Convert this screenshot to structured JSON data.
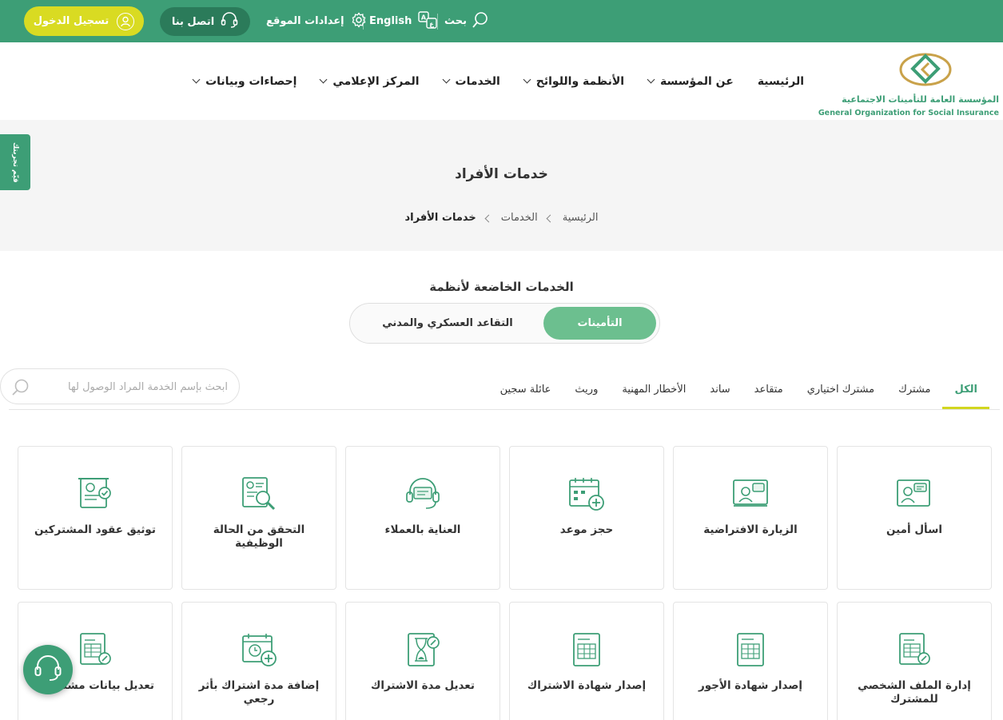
{
  "topbar": {
    "login_label": "تسجيل الدخول",
    "contact_label": "اتصل بنا",
    "settings_label": "إعدادات الموقع",
    "language_label": "English",
    "search_label": "بحث"
  },
  "logo": {
    "name_ar": "المؤسسة العامة للتأمينات الاجتماعية",
    "name_en": "General Organization for Social Insurance"
  },
  "mainnav": {
    "items": [
      {
        "label": "الرئيسية"
      },
      {
        "label": "عن المؤسسة"
      },
      {
        "label": "الأنظمة واللوائح"
      },
      {
        "label": "الخدمات"
      },
      {
        "label": "المركز الإعلامي"
      },
      {
        "label": "إحصاءات وبيانات"
      }
    ]
  },
  "sidebar_tab": {
    "label": "قيّم تجربتك"
  },
  "hero": {
    "title": "خدمات الأفراد",
    "breadcrumb": [
      "الرئيسية",
      "الخدمات",
      "خدمات الأفراد"
    ]
  },
  "systems": {
    "title": "الخدمات الخاضعة لأنظمة",
    "options": [
      "التأمينات",
      "التقاعد العسكري والمدني"
    ],
    "selected": "التأمينات"
  },
  "search": {
    "placeholder": "ابحث بإسم الخدمة المراد الوصول لها"
  },
  "tabs": {
    "items": [
      "الكل",
      "مشترك",
      "مشترك اختياري",
      "متقاعد",
      "ساند",
      "الأخطار المهنية",
      "وريث",
      "عائلة سجين"
    ],
    "active": "الكل"
  },
  "services": {
    "row1": [
      {
        "label": "اسأل أمين",
        "icon": "chat-agent-icon"
      },
      {
        "label": "الزيارة الافتراضية",
        "icon": "video-visit-icon"
      },
      {
        "label": "حجز موعد",
        "icon": "calendar-add-icon"
      },
      {
        "label": "العناية بالعملاء",
        "icon": "headset-icon"
      },
      {
        "label": "التحقق من الحالة الوظيفية",
        "icon": "id-search-icon"
      },
      {
        "label": "توثيق عقود المشتركين",
        "icon": "contract-check-icon"
      }
    ],
    "row2": [
      {
        "label": "إدارة الملف الشخصي للمشترك",
        "icon": "doc-edit-icon"
      },
      {
        "label": "إصدار شهادة الأجور",
        "icon": "doc-table-icon"
      },
      {
        "label": "إصدار شهادة الاشتراك",
        "icon": "doc-table-icon"
      },
      {
        "label": "تعديل مدة الاشتراك",
        "icon": "hourglass-edit-icon"
      },
      {
        "label": "إضافة مدة اشتراك بأثر رجعي",
        "icon": "calendar-clock-add-icon"
      },
      {
        "label": "تعديل بيانات مشتركين",
        "icon": "doc-edit-icon"
      }
    ]
  },
  "colors": {
    "primary": "#3d9e76",
    "accent": "#d9db22",
    "dark_green": "#2b7b5a"
  }
}
